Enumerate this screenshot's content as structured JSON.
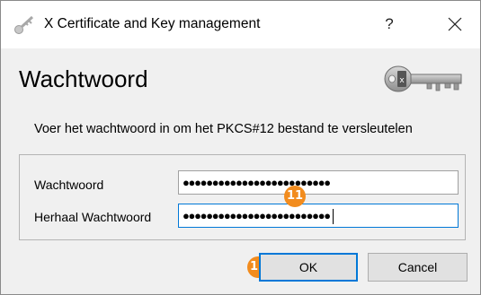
{
  "window": {
    "title": "X Certificate and Key management",
    "help_label": "?"
  },
  "dialog": {
    "heading": "Wachtwoord",
    "instruction": "Voer het wachtwoord in om het PKCS#12 bestand te versleutelen"
  },
  "form": {
    "password_label": "Wachtwoord",
    "password_value": "●●●●●●●●●●●●●●●●●●●●●●●●●",
    "repeat_label": "Herhaal Wachtwoord",
    "repeat_value": "●●●●●●●●●●●●●●●●●●●●●●●●●"
  },
  "buttons": {
    "ok_label": "OK",
    "cancel_label": "Cancel"
  },
  "markers": {
    "step_11": "11",
    "step_12": "12"
  },
  "icons": {
    "title": "key-icon",
    "header": "key-icon",
    "close": "close-icon"
  },
  "colors": {
    "accent": "#0078d7",
    "marker": "#f28c1e",
    "dialog_background": "#f0f0f0"
  }
}
